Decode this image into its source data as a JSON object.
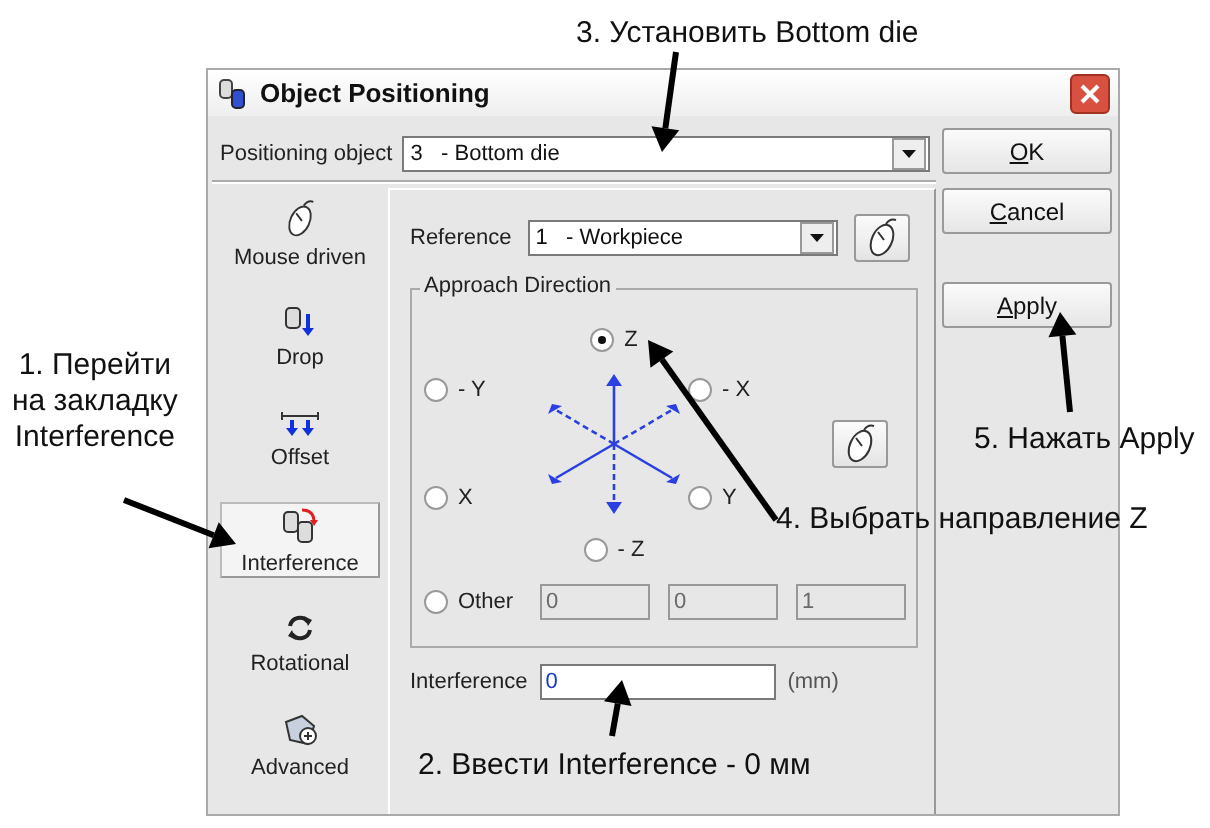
{
  "window": {
    "title": "Object Positioning"
  },
  "positioning_object": {
    "label": "Positioning object",
    "value": "3   - Bottom die"
  },
  "tabs": [
    {
      "label": "Mouse driven",
      "kind": "mouse",
      "selected": false
    },
    {
      "label": "Drop",
      "kind": "drop",
      "selected": false
    },
    {
      "label": "Offset",
      "kind": "offset",
      "selected": false
    },
    {
      "label": "Interference",
      "kind": "interference",
      "selected": true
    },
    {
      "label": "Rotational",
      "kind": "rotational",
      "selected": false
    },
    {
      "label": "Advanced",
      "kind": "advanced",
      "selected": false
    }
  ],
  "reference": {
    "label": "Reference",
    "value": "1   - Workpiece"
  },
  "approach_direction": {
    "title": "Approach Direction",
    "options": [
      {
        "label": "Z",
        "selected": true
      },
      {
        "label": "- Y",
        "selected": false
      },
      {
        "label": "- X",
        "selected": false
      },
      {
        "label": "X",
        "selected": false
      },
      {
        "label": "Y",
        "selected": false
      },
      {
        "label": "- Z",
        "selected": false
      }
    ],
    "other": {
      "label": "Other",
      "selected": false,
      "fields": [
        {
          "value": "0",
          "disabled": true
        },
        {
          "value": "0",
          "disabled": true
        },
        {
          "value": "1",
          "disabled": true
        }
      ]
    }
  },
  "interference": {
    "label": "Interference",
    "value": "0",
    "unit": "(mm)"
  },
  "buttons": [
    {
      "label": "OK"
    },
    {
      "label": "Cancel"
    },
    {
      "label": "Apply"
    }
  ],
  "annotations": [
    "3. Установить Bottom die",
    "1. Перейти\nна закладку\nInterference",
    "5. Нажать Apply",
    "4. Выбрать направление Z",
    "2. Ввести Interference - 0 мм"
  ]
}
